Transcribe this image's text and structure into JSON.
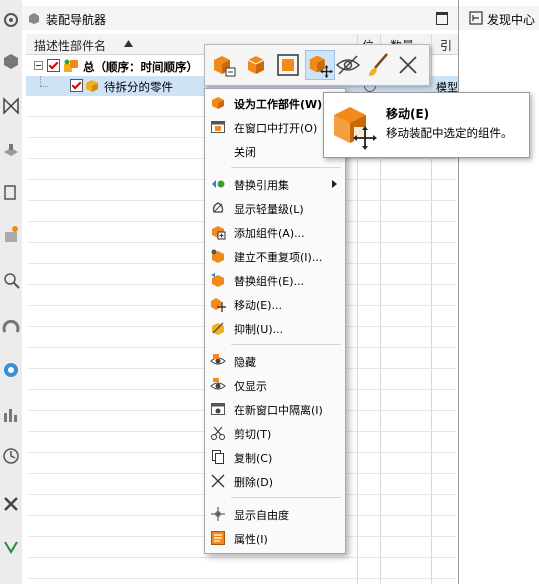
{
  "navigator": {
    "title": "装配导航器",
    "columns": {
      "name": "描述性部件名",
      "position": "位",
      "count": "数量",
      "reference": "引"
    },
    "tree": [
      {
        "label": "总（顺序：时间顺序）",
        "reference": ""
      },
      {
        "label": "待拆分的零件",
        "reference": "模型"
      }
    ]
  },
  "right_panel": {
    "title": "发现中心"
  },
  "popup_toolbar": {
    "items": [
      {
        "icon": "set-work-part-icon"
      },
      {
        "icon": "open-part-icon"
      },
      {
        "icon": "display-only-icon"
      },
      {
        "icon": "move-component-icon",
        "active": true
      },
      {
        "icon": "hide-icon"
      },
      {
        "icon": "brush-icon"
      },
      {
        "icon": "close-icon"
      }
    ]
  },
  "context_menu": {
    "items": [
      {
        "label": "设为工作部件(W)",
        "bold": true,
        "icon": "work-part-icon"
      },
      {
        "label": "在窗口中打开(O)",
        "icon": "open-in-window-icon"
      },
      {
        "label": "关闭",
        "icon": ""
      },
      {
        "label": "替换引用集",
        "icon": "replace-refset-icon",
        "submenu": true
      },
      {
        "label": "显示轻量级(L)",
        "icon": "lightweight-icon"
      },
      {
        "label": "添加组件(A)...",
        "icon": "add-component-icon"
      },
      {
        "label": "建立不重复项(I)...",
        "icon": "make-unique-icon"
      },
      {
        "label": "替换组件(E)...",
        "icon": "replace-component-icon"
      },
      {
        "label": "移动(E)...",
        "icon": "move-icon"
      },
      {
        "label": "抑制(U)...",
        "icon": "suppress-icon"
      },
      {
        "label": "隐藏",
        "icon": "hide-eye-icon"
      },
      {
        "label": "仅显示",
        "icon": "show-only-icon"
      },
      {
        "label": "在新窗口中隔离(I)",
        "icon": "isolate-icon"
      },
      {
        "label": "剪切(T)",
        "icon": "cut-icon"
      },
      {
        "label": "复制(C)",
        "icon": "copy-icon"
      },
      {
        "label": "删除(D)",
        "icon": "delete-icon"
      },
      {
        "label": "显示自由度",
        "icon": "dof-icon"
      },
      {
        "label": "属性(I)",
        "icon": "properties-icon"
      }
    ]
  },
  "tooltip": {
    "title": "移动(E)",
    "description": "移动装配中选定的组件。"
  },
  "colors": {
    "orange": "#f28a1a",
    "selection_blue": "#cfe3f7",
    "check_red": "#d40000"
  }
}
